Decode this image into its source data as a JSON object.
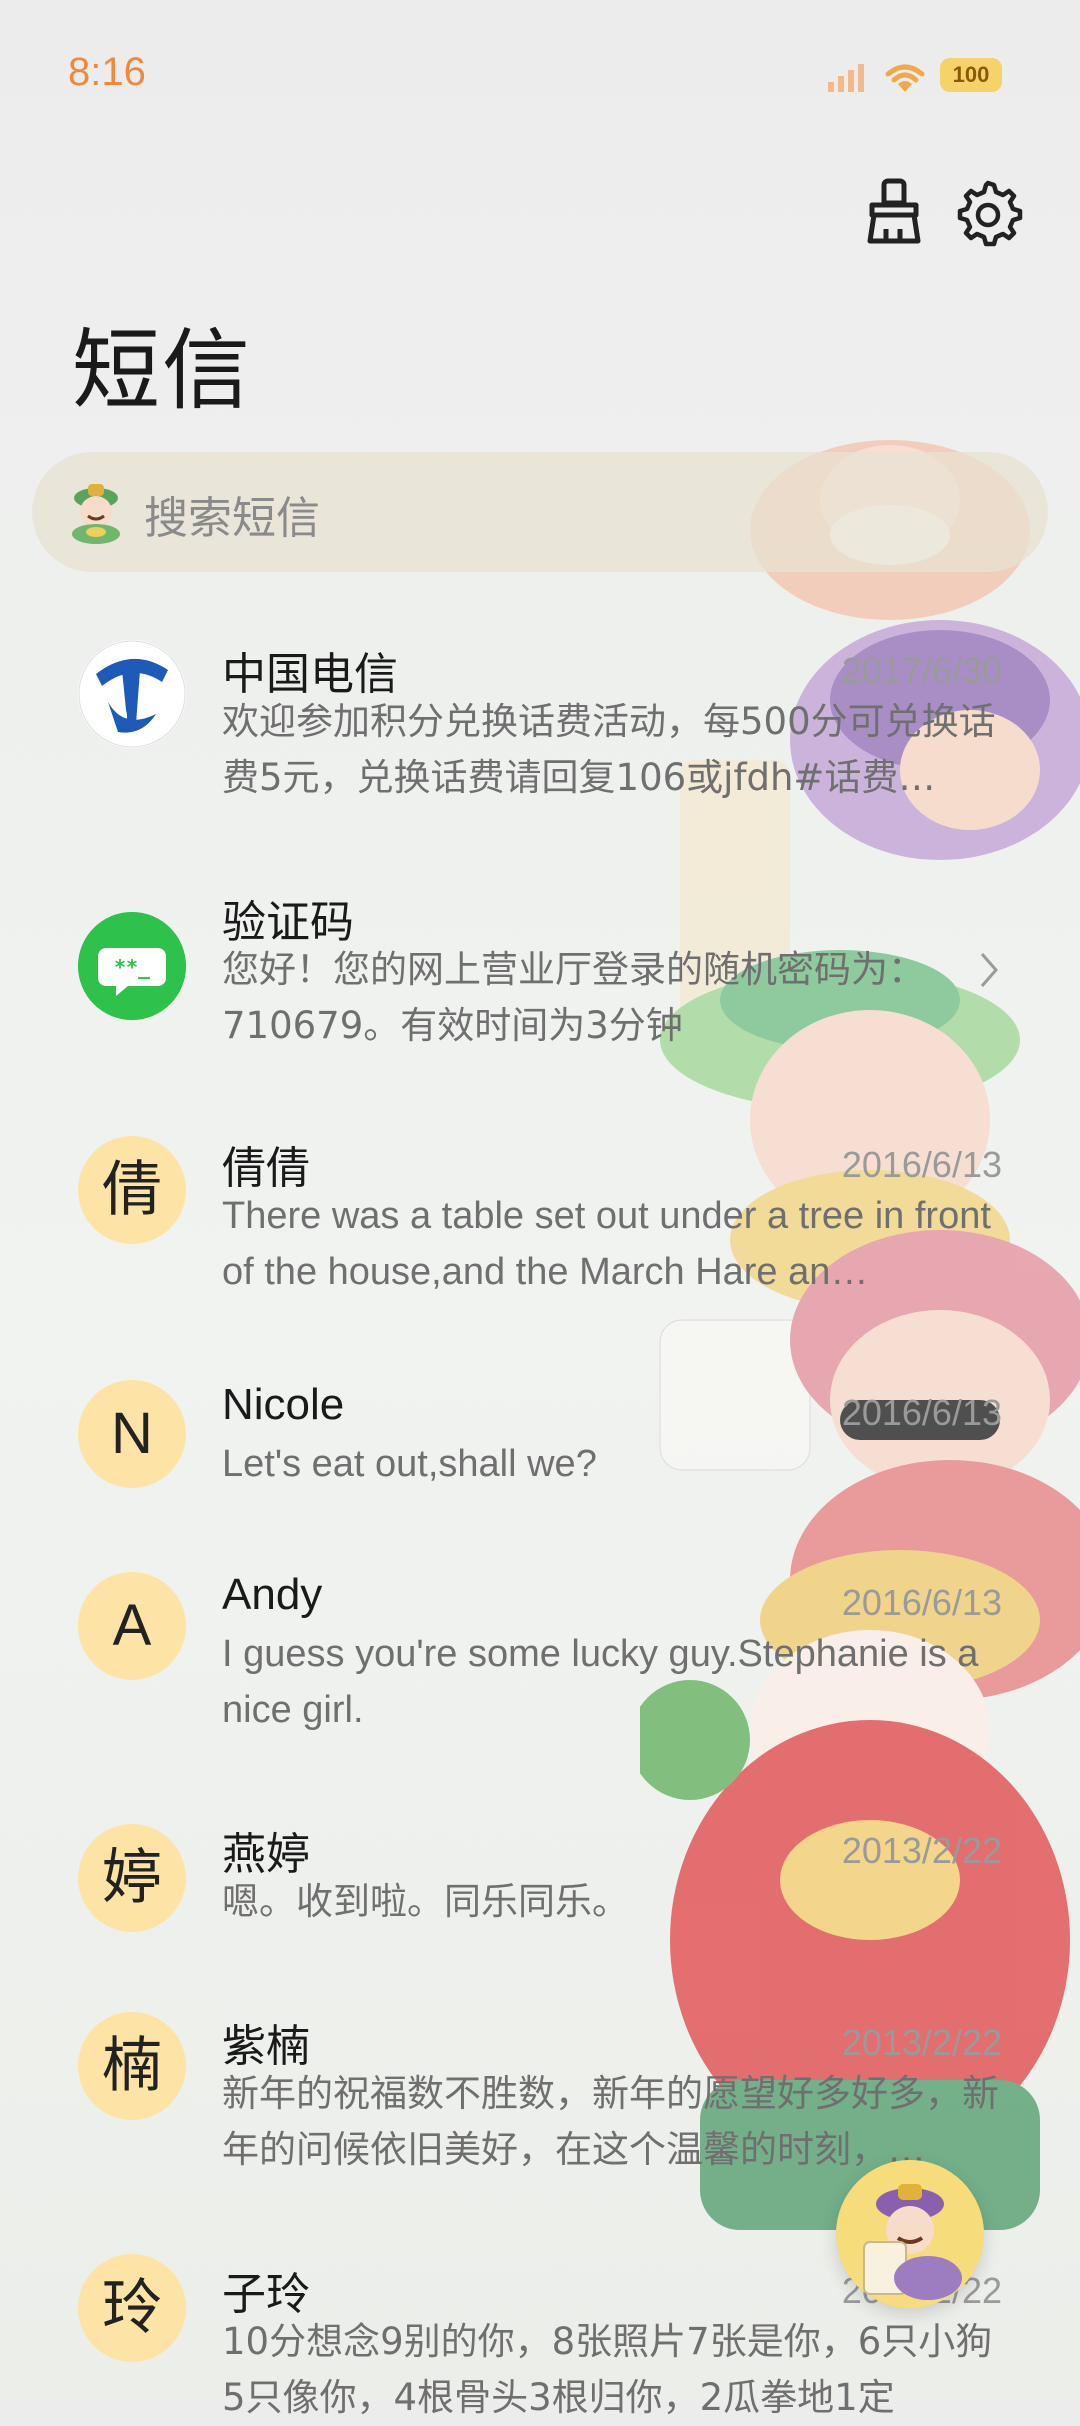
{
  "status_bar": {
    "time": "8:16",
    "battery": "100"
  },
  "header": {
    "title": "短信",
    "clean_icon": "broom-icon",
    "settings_icon": "gear-icon"
  },
  "search": {
    "placeholder": "搜索短信"
  },
  "colors": {
    "accent": "#ef8a3c",
    "avatar_bg": "#fde4a6",
    "battery": "#f6d36a",
    "verify_green": "#2ec24c",
    "telecom_blue": "#1e5bb8"
  },
  "conversations": [
    {
      "avatar": "telecom-logo",
      "name": "中国电信",
      "date": "2017/6/30",
      "preview": "欢迎参加积分兑换话费活动，每500分可兑换话费5元，兑换话费请回复106或jfdh#话费…"
    },
    {
      "avatar": "chat-bubble-icon",
      "name": "验证码",
      "date": "",
      "preview": "您好！您的网上营业厅登录的随机密码为：710679。有效时间为3分钟"
    },
    {
      "avatar": "倩",
      "name": "倩倩",
      "date": "2016/6/13",
      "preview": "There was a table set out under a tree in front of the house,and the March Hare an…"
    },
    {
      "avatar": "N",
      "name": "Nicole",
      "date": "2016/6/13",
      "preview": "Let's eat out,shall we?"
    },
    {
      "avatar": "A",
      "name": "Andy",
      "date": "2016/6/13",
      "preview": "I guess you're some lucky guy.Stephanie is a nice girl."
    },
    {
      "avatar": "婷",
      "name": "燕婷",
      "date": "2013/2/22",
      "preview": "嗯。收到啦。同乐同乐。"
    },
    {
      "avatar": "楠",
      "name": "紫楠",
      "date": "2013/2/22",
      "preview": "新年的祝福数不胜数，新年的愿望好多好多，新年的问候依旧美好，在这个温馨的时刻，…"
    },
    {
      "avatar": "玲",
      "name": "子玲",
      "date": "2013/2/22",
      "preview": "10分想念9别的你，8张照片7张是你，6只小狗5只像你，4根骨头3根归你，2瓜拳地1定"
    }
  ]
}
